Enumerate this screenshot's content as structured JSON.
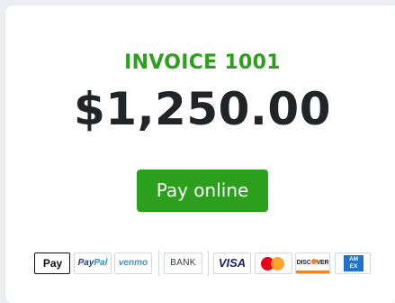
{
  "invoice": {
    "title": "INVOICE 1001",
    "amount": "$1,250.00",
    "pay_button_label": "Pay online"
  },
  "payment_methods": {
    "apple_pay": {
      "logo_glyph": "",
      "label": "Pay"
    },
    "paypal": {
      "part1": "Pay",
      "part2": "Pal"
    },
    "venmo": {
      "label": "venmo"
    },
    "bank": {
      "label": "BANK"
    },
    "visa": {
      "label": "VISA"
    },
    "mastercard": {
      "icon": "mastercard-icon"
    },
    "discover": {
      "part1": "DISC",
      "part2": "VER"
    },
    "amex": {
      "line1": "AM",
      "line2": "EX"
    }
  },
  "colors": {
    "accent_green": "#2ca01c",
    "amount_text": "#222427",
    "background": "#eceef1",
    "card": "#ffffff"
  }
}
